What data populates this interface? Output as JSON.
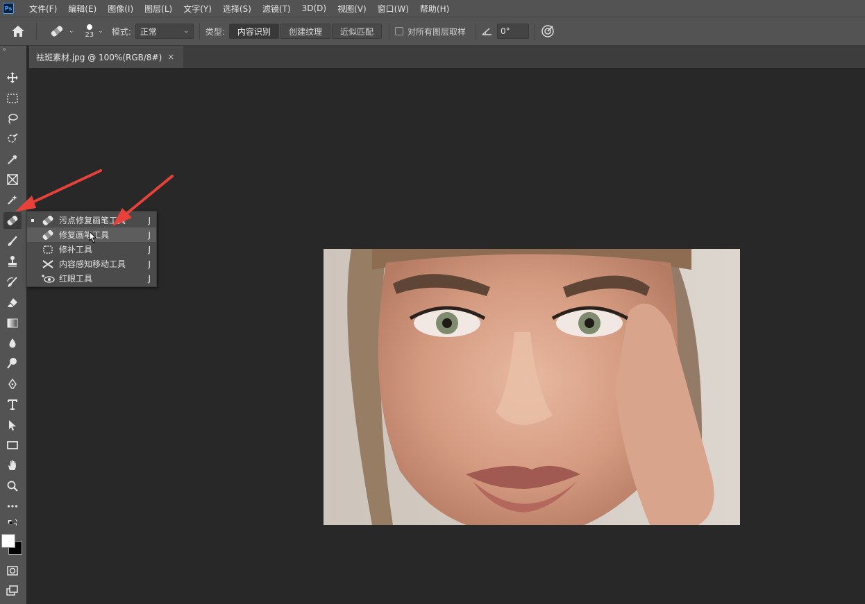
{
  "menubar": {
    "logo": "Ps",
    "items": [
      "文件(F)",
      "编辑(E)",
      "图像(I)",
      "图层(L)",
      "文字(Y)",
      "选择(S)",
      "滤镜(T)",
      "3D(D)",
      "视图(V)",
      "窗口(W)",
      "帮助(H)"
    ]
  },
  "options": {
    "brush_size": "23",
    "mode_label": "模式:",
    "mode_value": "正常",
    "type_label": "类型:",
    "type_buttons": [
      "内容识别",
      "创建纹理",
      "近似匹配"
    ],
    "sample_all_label": "对所有图层取样",
    "angle_value": "0°"
  },
  "document_tab": {
    "title": "祛斑素材.jpg @ 100%(RGB/8#)",
    "close": "×"
  },
  "toolbar": {
    "collapse": "»"
  },
  "flyout": {
    "items": [
      {
        "label": "污点修复画笔工具",
        "key": "J",
        "icon": "spot-healing-brush-icon"
      },
      {
        "label": "修复画笔工具",
        "key": "J",
        "icon": "healing-brush-icon"
      },
      {
        "label": "修补工具",
        "key": "J",
        "icon": "patch-icon"
      },
      {
        "label": "内容感知移动工具",
        "key": "J",
        "icon": "content-aware-move-icon"
      },
      {
        "label": "红眼工具",
        "key": "J",
        "icon": "red-eye-icon"
      }
    ]
  },
  "colors": {
    "annotation_arrow": "#e8413a",
    "ui_panel": "#535353",
    "canvas_bg": "#282828"
  }
}
